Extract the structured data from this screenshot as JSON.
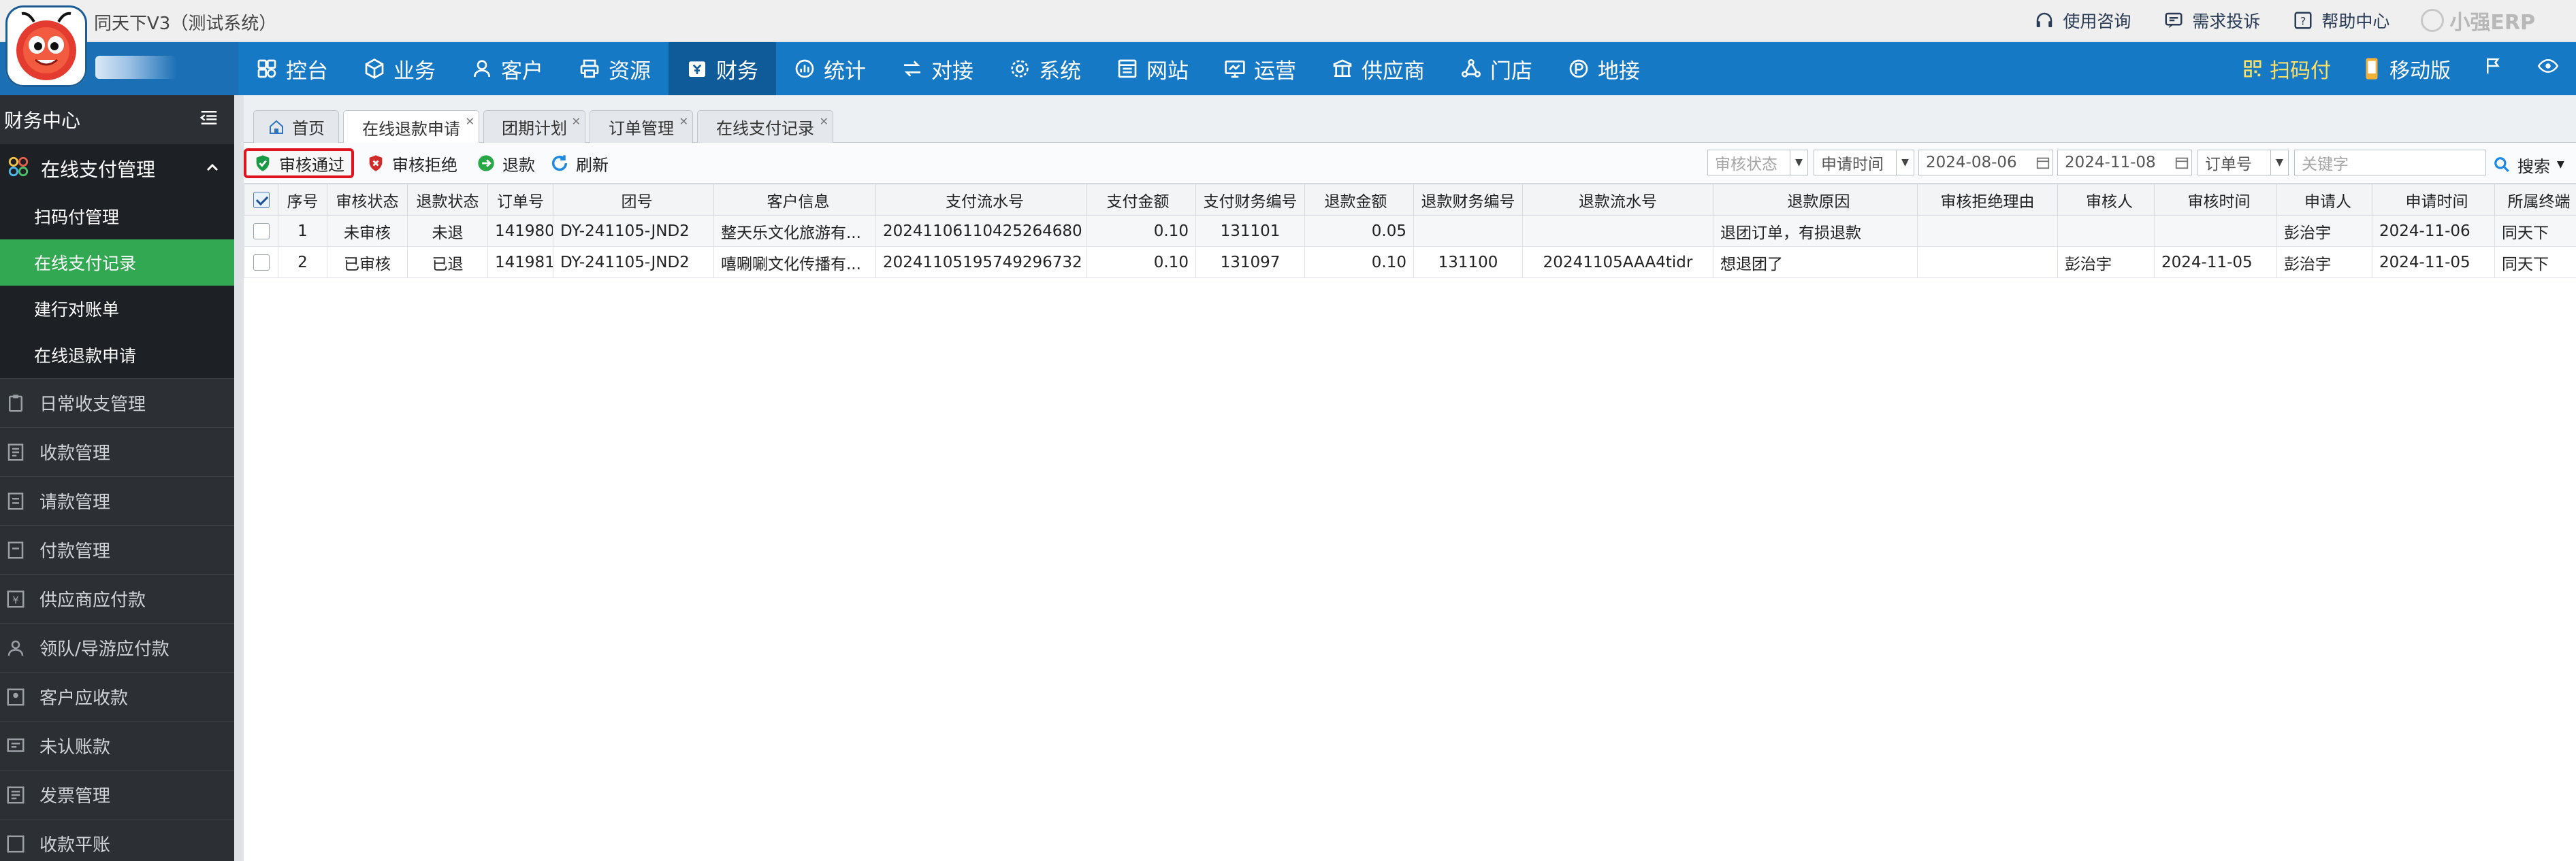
{
  "app_title": "同天下V3（测试系统）",
  "top_links": [
    {
      "label": "使用咨询",
      "icon": "headset-icon"
    },
    {
      "label": "需求投诉",
      "icon": "feedback-icon"
    },
    {
      "label": "帮助中心",
      "icon": "help-icon"
    }
  ],
  "brand": "小强ERP",
  "nav": {
    "items": [
      {
        "label": "控台",
        "icon": "dashboard-icon"
      },
      {
        "label": "业务",
        "icon": "cube-icon"
      },
      {
        "label": "客户",
        "icon": "user-icon"
      },
      {
        "label": "资源",
        "icon": "printer-icon"
      },
      {
        "label": "财务",
        "icon": "finance-icon",
        "active": true
      },
      {
        "label": "统计",
        "icon": "chart-icon"
      },
      {
        "label": "对接",
        "icon": "connect-icon"
      },
      {
        "label": "系统",
        "icon": "gear-icon"
      },
      {
        "label": "网站",
        "icon": "website-icon"
      },
      {
        "label": "运营",
        "icon": "monitor-icon"
      },
      {
        "label": "供应商",
        "icon": "supplier-icon"
      },
      {
        "label": "门店",
        "icon": "store-icon"
      },
      {
        "label": "地接",
        "icon": "local-icon"
      }
    ],
    "scan_pay": "扫码付",
    "mobile": "移动版"
  },
  "sidebar": {
    "title": "财务中心",
    "group": {
      "label": "在线支付管理",
      "icon": "apps-icon"
    },
    "sub_items": [
      {
        "label": "扫码付管理",
        "active": false
      },
      {
        "label": "在线支付记录",
        "active": true
      },
      {
        "label": "建行对账单",
        "active": false
      },
      {
        "label": "在线退款申请",
        "active": false
      }
    ],
    "items": [
      {
        "label": "日常收支管理",
        "icon": "clipboard-icon"
      },
      {
        "label": "收款管理",
        "icon": "receipt-icon"
      },
      {
        "label": "请款管理",
        "icon": "request-icon"
      },
      {
        "label": "付款管理",
        "icon": "payment-icon"
      },
      {
        "label": "供应商应付款",
        "icon": "supplier-pay-icon"
      },
      {
        "label": "领队/导游应付款",
        "icon": "guide-icon"
      },
      {
        "label": "客户应收款",
        "icon": "customer-icon"
      },
      {
        "label": "未认账款",
        "icon": "unconfirmed-icon"
      },
      {
        "label": "发票管理",
        "icon": "invoice-icon"
      },
      {
        "label": "收款平账",
        "icon": "balance-icon"
      }
    ]
  },
  "tabs": [
    {
      "label": "首页",
      "icon": "home-icon",
      "closable": false
    },
    {
      "label": "在线退款申请",
      "active": true,
      "closable": true
    },
    {
      "label": "团期计划",
      "closable": true
    },
    {
      "label": "订单管理",
      "closable": true
    },
    {
      "label": "在线支付记录",
      "closable": true
    }
  ],
  "toolbar": {
    "approve": "审核通过",
    "reject": "审核拒绝",
    "refund": "退款",
    "refresh": "刷新",
    "filters": {
      "status_placeholder": "审核状态",
      "date_type": "申请时间",
      "date_from": "2024-08-06",
      "date_to": "2024-11-08",
      "field": "订单号",
      "keyword_placeholder": "关键字"
    },
    "search": "搜索"
  },
  "table": {
    "headers": [
      "序号",
      "审核状态",
      "退款状态",
      "订单号",
      "团号",
      "客户信息",
      "支付流水号",
      "支付金额",
      "支付财务编号",
      "退款金额",
      "退款财务编号",
      "退款流水号",
      "退款原因",
      "审核拒绝理由",
      "审核人",
      "审核时间",
      "申请人",
      "申请时间",
      "所属终端"
    ],
    "rows": [
      [
        "1",
        "未审核",
        "未退",
        "141980",
        "DY-241105-JND2",
        "整天乐文化旅游有...",
        "20241106110425264680",
        "0.10",
        "131101",
        "0.05",
        "",
        "",
        "退团订单，有损退款",
        "",
        "",
        "",
        "彭治宇",
        "2024-11-06",
        "同天下"
      ],
      [
        "2",
        "已审核",
        "已退",
        "141981",
        "DY-241105-JND2",
        "嘻唰唰文化传播有...",
        "20241105195749296732",
        "0.10",
        "131097",
        "0.10",
        "131100",
        "20241105AAA4tidr",
        "想退团了",
        "",
        "彭治宇",
        "2024-11-05",
        "彭治宇",
        "2024-11-05",
        "同天下"
      ]
    ]
  }
}
